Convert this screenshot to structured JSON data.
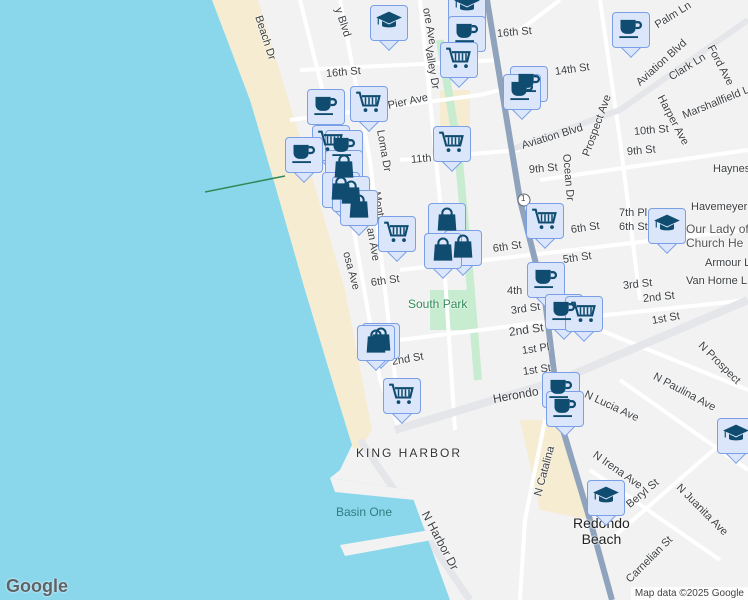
{
  "map": {
    "labels": {
      "beach_dr": "Beach Dr",
      "valley_blvd": "y Blvd",
      "ardmore": "ore Ave",
      "valley_dr": "Valley Dr",
      "st16_w": "16th St",
      "st16_e": "16th St",
      "pier": "Pier Ave",
      "loma": "Loma Dr",
      "st11": "11th",
      "st14": "14th St",
      "aviation1": "Aviation Blvd",
      "aviation2": "Aviation Blvd",
      "palm": "Palm Ln",
      "clark": "Clark Ln",
      "ford": "Ford Ave",
      "harper": "Harper Ave",
      "marshallfield": "Marshallfield Ln",
      "st10": "10th St",
      "st9a": "9th St",
      "st9b": "9th St",
      "prospect": "Prospect Ave",
      "ocean": "Ocean Dr",
      "haynes": "Haynes",
      "havemeyer": "Havemeyer",
      "pl7": "7th Pl",
      "st6a": "6th St",
      "st6b": "6th St",
      "st6c": "6th St",
      "st6d": "6th St",
      "st5": "5th St",
      "monterey": "Monte",
      "manhattan": "an Ave",
      "hermosa": "osa Ave",
      "armour": "Armour L",
      "vanhorne": "Van Horne L",
      "st3a": "3rd St",
      "st3b": "3rd St",
      "st4": "4th",
      "st2a": "2nd St",
      "st2b": "2nd St",
      "st2c": "2nd St",
      "st1a": "1st St",
      "st1b": "1st St",
      "pl1": "1st Pl",
      "herondo": "Herondo",
      "lucia": "N Lucia Ave",
      "paulina": "N Paulina Ave",
      "nprospect": "N Prospect",
      "irena": "N Irena Ave",
      "juanita": "N Juanita Ave",
      "beryl": "Beryl St",
      "catalina": "N Catalina",
      "carnelian": "Carnelian St",
      "harbor_dr": "N Harbor Dr",
      "church": "Our Lady of\nChurch He",
      "hwy": "1"
    },
    "places": {
      "south_park": "South Park",
      "king_harbor": "KING HARBOR",
      "basin_one": "Basin One",
      "redondo": "Redondo\nBeach"
    },
    "logo": "Google",
    "attribution": "Map data ©2025 Google"
  },
  "colors": {
    "ocean": "#8ad7ec",
    "sand": "#f6ecd2",
    "land": "#f3f2f2",
    "road": "#ffffff",
    "highway": "#8fa3bd",
    "park": "#c7ecd0",
    "marker_fill": "#dce6fb",
    "icon": "#0f4c6f"
  }
}
